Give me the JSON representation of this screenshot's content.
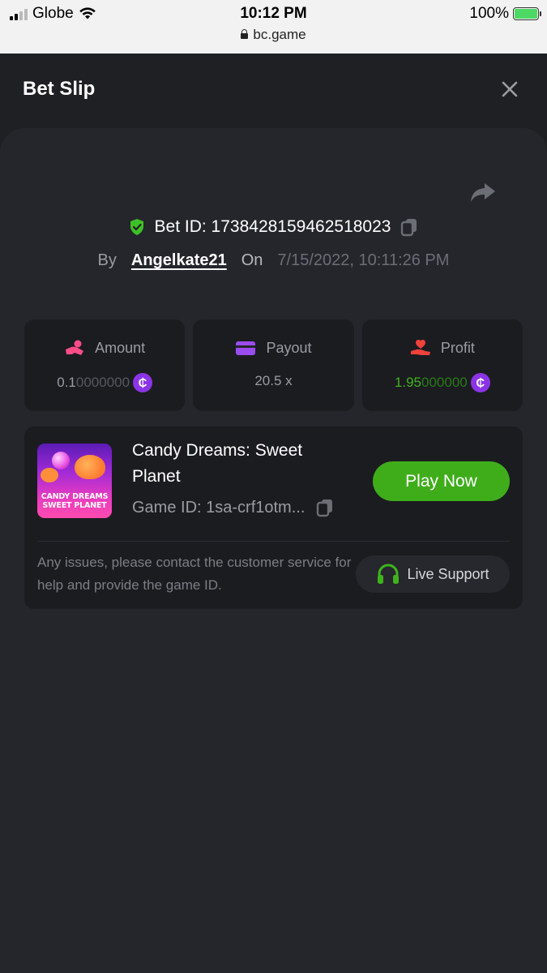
{
  "status_bar": {
    "carrier": "Globe",
    "time": "10:12 PM",
    "url": "bc.game",
    "battery": "100%"
  },
  "header": {
    "title": "Bet Slip"
  },
  "bet": {
    "id_label": "Bet ID: 1738428159462518023",
    "by_label": "By",
    "username": "Angelkate21",
    "on_label": "On",
    "date": "7/15/2022, 10:11:26 PM"
  },
  "stats": {
    "amount": {
      "label": "Amount",
      "value_main": "0.1",
      "value_faded": "0000000"
    },
    "payout": {
      "label": "Payout",
      "value": "20.5 x"
    },
    "profit": {
      "label": "Profit",
      "value_main": "1.95",
      "value_faded": "000000"
    }
  },
  "coin_symbol": "₵",
  "game": {
    "title": "Candy Dreams: Sweet Planet",
    "thumb_text_1": "CANDY DREAMS",
    "thumb_text_2": "SWEET PLANET",
    "id_label": "Game ID: 1sa-crf1otm...",
    "play_label": "Play Now"
  },
  "support": {
    "text": "Any issues, please contact the customer service for help and provide the game ID.",
    "button_label": "Live Support"
  },
  "colors": {
    "background": "#1f2023",
    "panel": "#24262b",
    "card": "#1b1c20",
    "accent_green": "#3fad1a",
    "shield_green": "#3ec126",
    "coin_purple": "#8b34e6",
    "amount_pink": "#ff4d88",
    "payout_purple": "#9b4cf0",
    "profit_red": "#f0413b"
  },
  "icons": {
    "close": "close-icon",
    "share": "share-icon",
    "shield": "shield-check-icon",
    "copy": "copy-icon",
    "amount": "hand-coin-icon",
    "payout": "card-icon",
    "profit": "hand-heart-icon",
    "coin": "coin-icon",
    "headset": "headset-icon"
  }
}
